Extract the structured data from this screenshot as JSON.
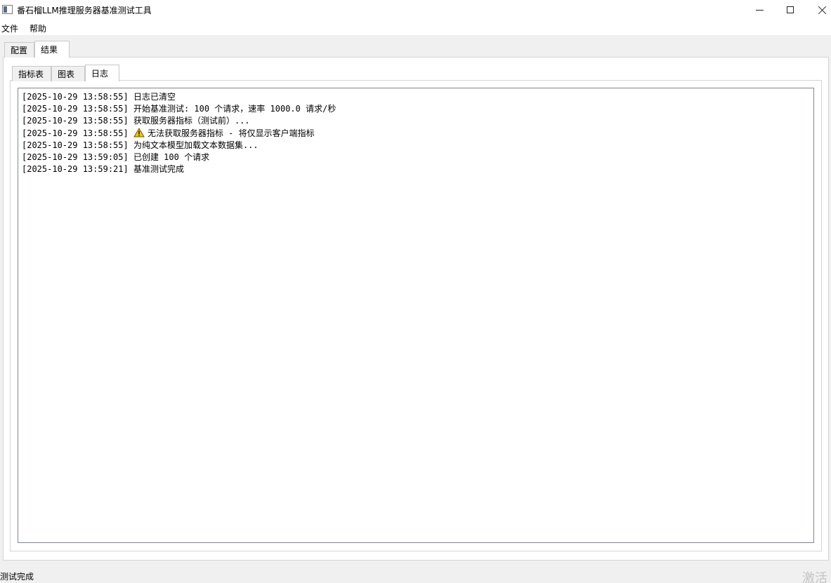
{
  "window": {
    "title": "番石榴LLM推理服务器基准测试工具"
  },
  "menu": {
    "file": "文件",
    "help": "帮助"
  },
  "tabs": {
    "config": "配置",
    "results": "结果"
  },
  "subtabs": {
    "metrics": "指标表",
    "chart": "图表",
    "log": "日志"
  },
  "log": {
    "lines": [
      {
        "time": "[2025-10-29 13:58:55]",
        "warn": false,
        "text": "日志已清空"
      },
      {
        "time": "[2025-10-29 13:58:55]",
        "warn": false,
        "text": "开始基准测试: 100 个请求，速率 1000.0 请求/秒"
      },
      {
        "time": "[2025-10-29 13:58:55]",
        "warn": false,
        "text": "获取服务器指标（测试前）..."
      },
      {
        "time": "[2025-10-29 13:58:55]",
        "warn": true,
        "text": "无法获取服务器指标 - 将仅显示客户端指标"
      },
      {
        "time": "[2025-10-29 13:58:55]",
        "warn": false,
        "text": "为纯文本模型加载文本数据集..."
      },
      {
        "time": "[2025-10-29 13:59:05]",
        "warn": false,
        "text": "已创建 100 个请求"
      },
      {
        "time": "[2025-10-29 13:59:21]",
        "warn": false,
        "text": "基准测试完成"
      }
    ]
  },
  "status": {
    "text": "测试完成",
    "watermark": "激活"
  },
  "icons": {
    "warning": "warning-icon",
    "app": "app-icon",
    "minimize": "minimize-icon",
    "maximize": "maximize-icon",
    "close": "close-icon"
  },
  "colors": {
    "warning_fill": "#f5c400",
    "log_border": "#828790",
    "background": "#f0f0f0"
  }
}
